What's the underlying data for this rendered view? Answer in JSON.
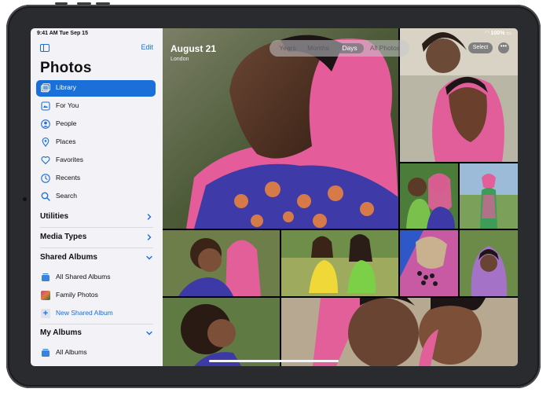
{
  "status": {
    "time_date": "9:41 AM  Tue Sep 15",
    "battery": "100%"
  },
  "sidebar": {
    "edit_label": "Edit",
    "title": "Photos",
    "items": [
      {
        "label": "Library",
        "icon": "photo-library-icon",
        "selected": true
      },
      {
        "label": "For You",
        "icon": "for-you-icon",
        "selected": false
      },
      {
        "label": "People",
        "icon": "person-icon",
        "selected": false
      },
      {
        "label": "Places",
        "icon": "map-pin-icon",
        "selected": false
      },
      {
        "label": "Favorites",
        "icon": "heart-icon",
        "selected": false
      },
      {
        "label": "Recents",
        "icon": "clock-icon",
        "selected": false
      },
      {
        "label": "Search",
        "icon": "search-icon",
        "selected": false
      }
    ],
    "sections": {
      "utilities": "Utilities",
      "media_types": "Media Types",
      "shared_albums": "Shared Albums",
      "my_albums": "My Albums"
    },
    "shared_album_items": [
      "All Shared Albums",
      "Family Photos",
      "New Shared Album"
    ],
    "my_album_items": [
      "All Albums"
    ]
  },
  "main": {
    "date_title": "August 21",
    "location": "London",
    "view_tabs": [
      {
        "label": "Years",
        "active": false
      },
      {
        "label": "Months",
        "active": false
      },
      {
        "label": "Days",
        "active": true
      },
      {
        "label": "All Photos",
        "active": false
      }
    ],
    "select_label": "Select",
    "more_label": "•••"
  },
  "colors": {
    "accent": "#1a6fd9",
    "sidebar_bg": "#f2f2f7",
    "selected_text": "#ffffff"
  }
}
